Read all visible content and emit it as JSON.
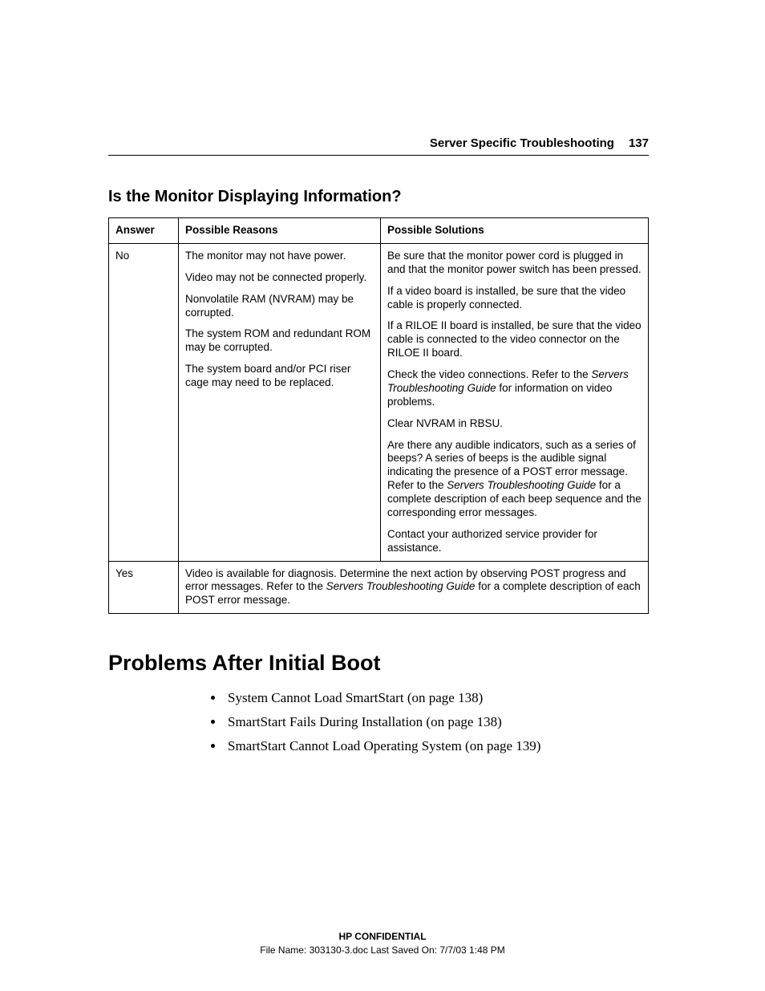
{
  "header": {
    "section": "Server Specific Troubleshooting",
    "page_number": "137"
  },
  "section1": {
    "title": "Is the Monitor Displaying Information?",
    "columns": {
      "answer": "Answer",
      "reasons": "Possible Reasons",
      "solutions": "Possible Solutions"
    },
    "row_no": {
      "answer": "No",
      "reasons": {
        "p1": "The monitor may not have power.",
        "p2": "Video may not be connected properly.",
        "p3": "Nonvolatile RAM (NVRAM) may be corrupted.",
        "p4": "The system ROM and redundant ROM may be corrupted.",
        "p5": "The system board and/or PCI riser cage may need to be replaced."
      },
      "solutions": {
        "p1": "Be sure that the monitor power cord is plugged in and that the monitor power switch has been pressed.",
        "p2": "If a video board is installed, be sure that the video cable is properly connected.",
        "p3": "If a RILOE II board is installed, be sure that the video cable is connected to the video connector on the RILOE II board.",
        "p4a": "Check the video connections. Refer to the ",
        "p4i": "Servers Troubleshooting Guide",
        "p4b": " for information on video problems.",
        "p5": "Clear NVRAM in RBSU.",
        "p6a": "Are there any audible indicators, such as a series of beeps? A series of beeps is the audible signal indicating the presence of a POST error message. Refer to the ",
        "p6i": "Servers Troubleshooting Guide",
        "p6b": " for a complete description of each beep sequence and the corresponding error messages.",
        "p7": "Contact your authorized service provider for assistance."
      }
    },
    "row_yes": {
      "answer": "Yes",
      "text_a": "Video is available for diagnosis. Determine the next action by observing POST progress and error messages. Refer to the ",
      "text_i": "Servers Troubleshooting Guide",
      "text_b": " for a complete description of each POST error message."
    }
  },
  "section2": {
    "title": "Problems After Initial Boot",
    "items": {
      "i1": "System Cannot Load SmartStart (on page 138)",
      "i2": "SmartStart Fails During Installation (on page 138)",
      "i3": "SmartStart Cannot Load Operating System (on page 139)"
    }
  },
  "footer": {
    "confidential": "HP CONFIDENTIAL",
    "fileinfo": "File Name: 303130-3.doc   Last Saved On: 7/7/03 1:48 PM"
  }
}
